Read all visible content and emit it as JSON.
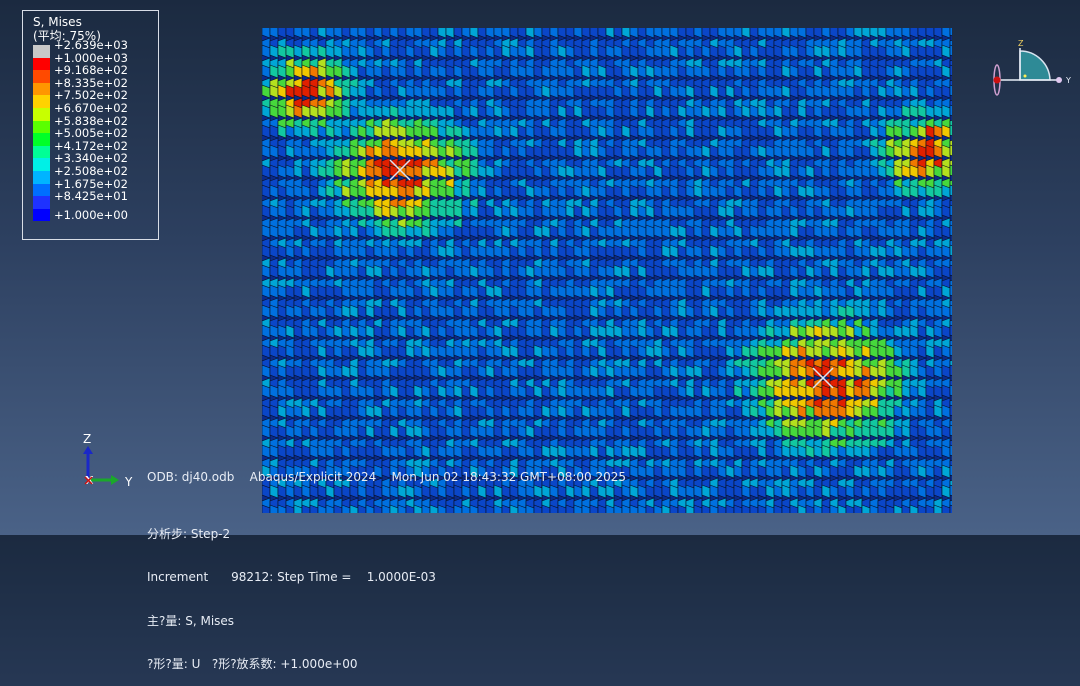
{
  "legend": {
    "title": "S, Mises",
    "subtitle": "(平均: 75%)",
    "entries": [
      {
        "value": "+2.639e+03",
        "color": "#c8c8c8"
      },
      {
        "value": "+1.000e+03",
        "color": "#ff0000"
      },
      {
        "value": "+9.168e+02",
        "color": "#ff4a00"
      },
      {
        "value": "+8.335e+02",
        "color": "#ff9600"
      },
      {
        "value": "+7.502e+02",
        "color": "#ffd200"
      },
      {
        "value": "+6.670e+02",
        "color": "#c8ff00"
      },
      {
        "value": "+5.838e+02",
        "color": "#5aff00"
      },
      {
        "value": "+5.005e+02",
        "color": "#00ff28"
      },
      {
        "value": "+4.172e+02",
        "color": "#00ff96"
      },
      {
        "value": "+3.340e+02",
        "color": "#00f0e6"
      },
      {
        "value": "+2.508e+02",
        "color": "#00b4ff"
      },
      {
        "value": "+1.675e+02",
        "color": "#006eff"
      },
      {
        "value": "+8.425e+01",
        "color": "#1e32ff"
      },
      {
        "value": "+1.000e+00",
        "color": "#0000ff"
      }
    ]
  },
  "triad_top": {
    "z_label": "Z",
    "y_label": "Y"
  },
  "triad_bottom": {
    "z_label": "Z",
    "y_label": "Y",
    "x_label": "X"
  },
  "info": {
    "line1": "ODB: dj40.odb    Abaqus/Explicit 2024    Mon Jun 02 18:43:32 GMT+08:00 2025",
    "line2": "分析步: Step-2",
    "line3": "Increment      98212: Step Time =    1.0000E-03",
    "line4": "主?量: S, Mises",
    "line5": "?形?量: U   ?形?放系数: +1.000e+00"
  },
  "colors": {
    "background_top": "#1b2a40",
    "background_bottom": "#4a6287",
    "mesh_base": "#0a2a8a",
    "mesh_line": "#0a0f1e"
  }
}
